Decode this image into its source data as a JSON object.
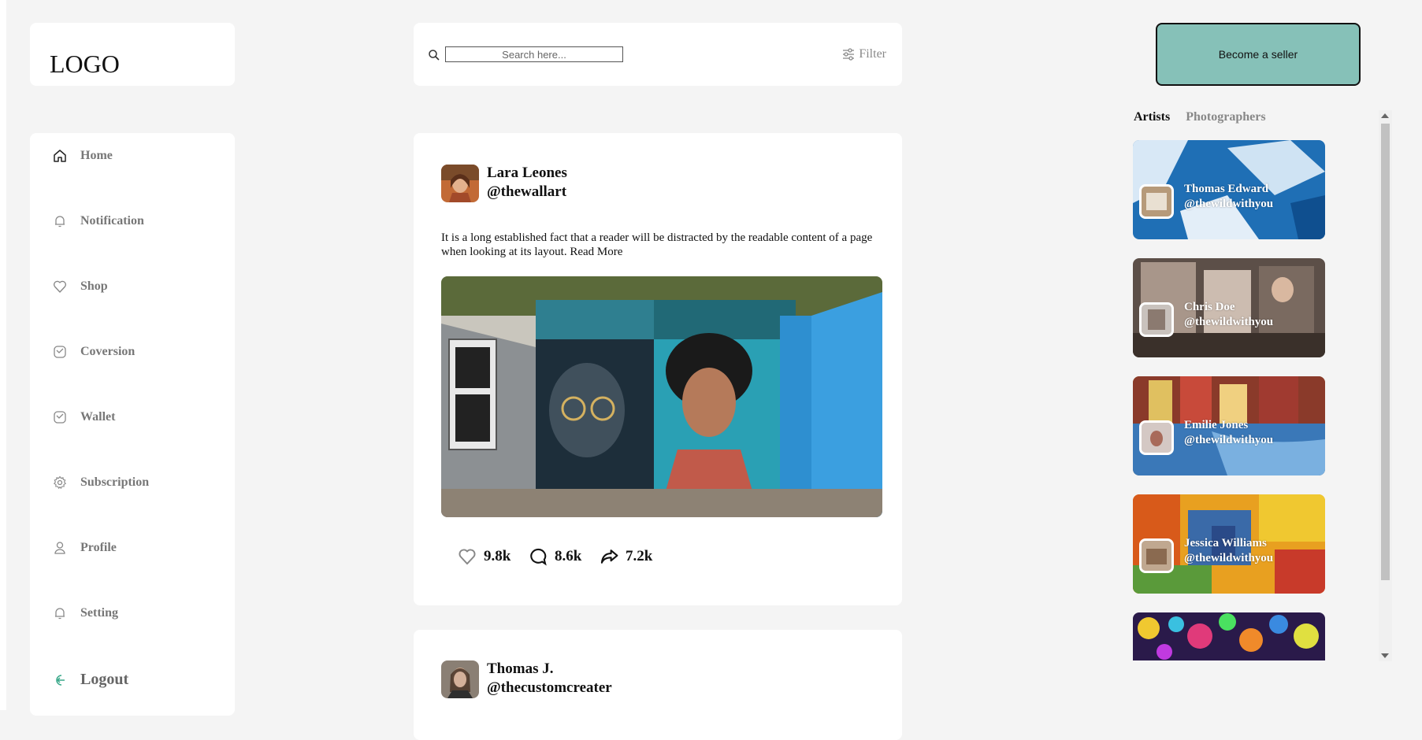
{
  "logo": {
    "text": "LOGO"
  },
  "nav": {
    "items": [
      {
        "label": "Home",
        "icon": "home-icon"
      },
      {
        "label": "Notification",
        "icon": "bell-icon"
      },
      {
        "label": "Shop",
        "icon": "heart-icon"
      },
      {
        "label": "Coversion",
        "icon": "chart-icon"
      },
      {
        "label": "Wallet",
        "icon": "wallet-icon"
      },
      {
        "label": "Subscription",
        "icon": "gear-icon"
      },
      {
        "label": "Profile",
        "icon": "user-icon"
      },
      {
        "label": "Setting",
        "icon": "bell-icon"
      },
      {
        "label": "Logout",
        "icon": "logout-icon"
      }
    ]
  },
  "search": {
    "placeholder": "Search here...",
    "filter_label": "Filter"
  },
  "post": {
    "author_name": "Lara Leones",
    "author_handle": "@thewallart",
    "text": "It is a long established fact that a reader will be distracted by the readable content of a page when looking at its layout. Read More",
    "likes": "9.8k",
    "comments": "8.6k",
    "shares": "7.2k"
  },
  "post2": {
    "author_name": "Thomas J.",
    "author_handle": "@thecustomcreater"
  },
  "seller_button": "Become a seller",
  "tabs": {
    "artists": "Artists",
    "photographers": "Photographers"
  },
  "artists": [
    {
      "name": "Thomas Edward",
      "handle": "@thewildwithyou"
    },
    {
      "name": "Chris Doe",
      "handle": "@thewildwithyou"
    },
    {
      "name": "Emilie Jones",
      "handle": "@thewildwithyou"
    },
    {
      "name": "Jessica Williams",
      "handle": "@thewildwithyou"
    }
  ],
  "colors": {
    "accent": "#86c1b8",
    "logout_icon": "#3aa88a"
  }
}
